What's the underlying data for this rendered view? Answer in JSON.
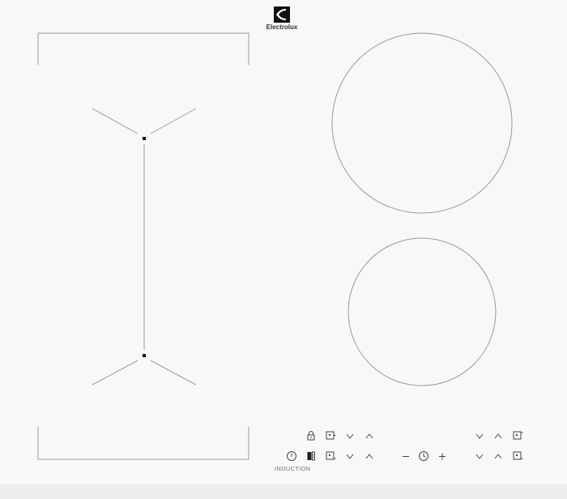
{
  "appliance": {
    "brand": "Electrolux",
    "type_label": "INDUCTION",
    "surface_color": "#f8f8f8",
    "line_color": "#9a9a9a"
  },
  "zones": [
    {
      "name": "bridge-zone-left",
      "kind": "flexi-bridge"
    },
    {
      "name": "round-zone-rear-right",
      "kind": "round"
    },
    {
      "name": "round-zone-front-right",
      "kind": "round"
    }
  ],
  "controls": {
    "top_row": [
      "lock-icon",
      "bridge-icon",
      "minus-chevron-icon",
      "plus-chevron-icon",
      "down-chevron-icon",
      "up-chevron-icon",
      "zone-select-icon"
    ],
    "bottom_row": [
      "power-icon",
      "booster-icon",
      "zone-select-icon",
      "down-chevron-icon",
      "up-chevron-icon",
      "minus-icon",
      "timer-icon",
      "plus-icon",
      "down-chevron-icon",
      "up-chevron-icon",
      "zone-select-icon"
    ]
  }
}
